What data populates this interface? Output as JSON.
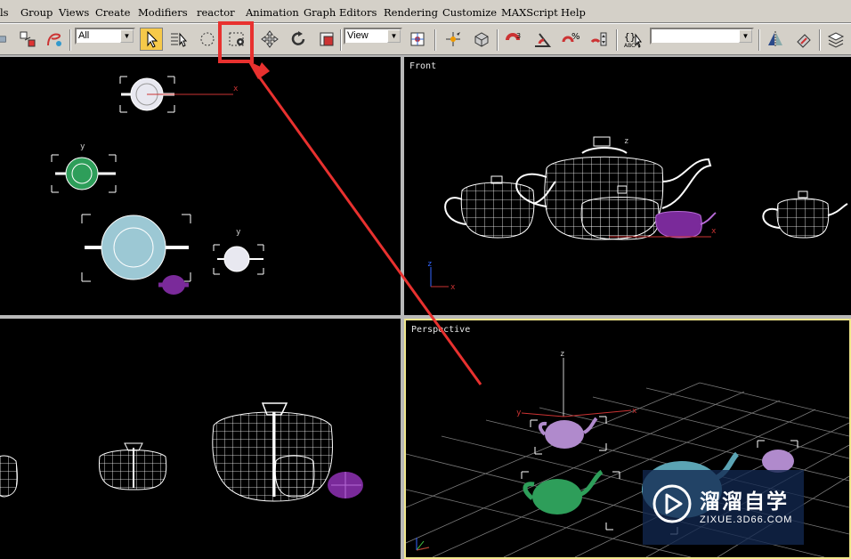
{
  "menu": {
    "items": [
      "ls",
      "Group",
      "Views",
      "Create",
      "Modifiers",
      "reactor",
      "Animation",
      "Graph Editors",
      "Rendering",
      "Customize",
      "MAXScript",
      "Help"
    ]
  },
  "toolbar": {
    "selection_filter": "All",
    "reference_coord_system": "View",
    "named_selection_sets": "",
    "highlighted_tool": "select-and-place-icon"
  },
  "viewports": {
    "top_left": {
      "label": "",
      "active": false
    },
    "front": {
      "label": "Front"
    },
    "bottom_left": {
      "label": ""
    },
    "perspective": {
      "label": "Perspective",
      "active": true
    }
  },
  "axis_labels": {
    "x": "x",
    "y": "y",
    "z": "z"
  },
  "colors": {
    "ui_face": "#d4d0c8",
    "active_border": "#f0e68c",
    "annotation_red": "#e8312f",
    "teapot_purple": "#7a2a9a",
    "teapot_green": "#2e9e5a",
    "teapot_lavender": "#b08acc",
    "teapot_teal": "#5ba4b4"
  },
  "watermark": {
    "title": "溜溜自学",
    "url": "ZIXUE.3D66.COM"
  }
}
